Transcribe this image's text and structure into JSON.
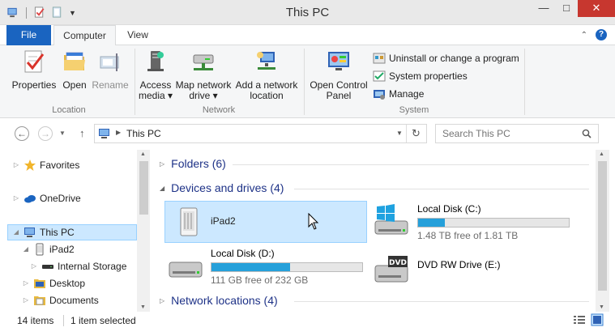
{
  "window": {
    "title": "This PC"
  },
  "tabs": {
    "file": "File",
    "computer": "Computer",
    "view": "View"
  },
  "ribbon": {
    "location": {
      "label": "Location",
      "properties": "Properties",
      "open": "Open",
      "rename": "Rename"
    },
    "network": {
      "label": "Network",
      "access_media_1": "Access",
      "access_media_2": "media ▾",
      "map_drive_1": "Map network",
      "map_drive_2": "drive ▾",
      "add_location_1": "Add a network",
      "add_location_2": "location"
    },
    "system": {
      "label": "System",
      "open_cp_1": "Open Control",
      "open_cp_2": "Panel",
      "uninstall": "Uninstall or change a program",
      "sysprops": "System properties",
      "manage": "Manage"
    }
  },
  "address": {
    "path": "This PC",
    "search_placeholder": "Search This PC"
  },
  "nav": {
    "favorites": "Favorites",
    "onedrive": "OneDrive",
    "thispc": "This PC",
    "ipad": "iPad2",
    "internal": "Internal Storage",
    "desktop": "Desktop",
    "documents": "Documents"
  },
  "content": {
    "folders": "Folders (6)",
    "devices": "Devices and drives (4)",
    "network": "Network locations (4)",
    "ipad": {
      "name": "iPad2"
    },
    "c": {
      "name": "Local Disk (C:)",
      "free": "1.48 TB free of 1.81 TB",
      "used_fraction": 0.18
    },
    "d": {
      "name": "Local Disk (D:)",
      "free": "111 GB free of 232 GB",
      "used_fraction": 0.52
    },
    "e": {
      "name": "DVD RW Drive (E:)"
    }
  },
  "status": {
    "items": "14 items",
    "selected": "1 item selected"
  }
}
